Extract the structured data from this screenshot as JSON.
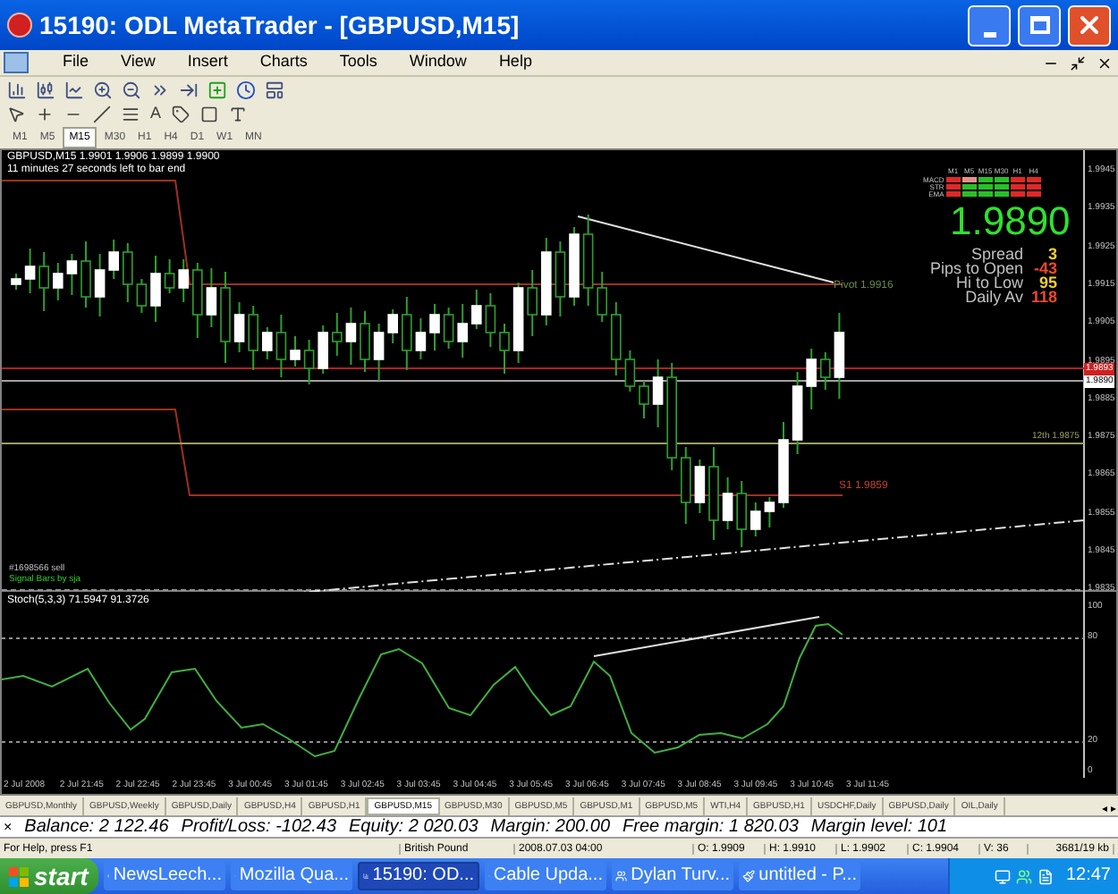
{
  "window": {
    "title": "15190: ODL MetaTrader - [GBPUSD,M15]"
  },
  "menu": [
    "File",
    "View",
    "Insert",
    "Charts",
    "Tools",
    "Window",
    "Help"
  ],
  "text_tool": "A",
  "timeframes": [
    {
      "label": "M1",
      "selected": false
    },
    {
      "label": "M5",
      "selected": false
    },
    {
      "label": "M15",
      "selected": true
    },
    {
      "label": "M30",
      "selected": false
    },
    {
      "label": "H1",
      "selected": false
    },
    {
      "label": "H4",
      "selected": false
    },
    {
      "label": "D1",
      "selected": false
    },
    {
      "label": "W1",
      "selected": false
    },
    {
      "label": "MN",
      "selected": false
    }
  ],
  "chart": {
    "header": "GBPUSD,M15  1.9901 1.9906 1.9899 1.9900",
    "countdown": "11 minutes 27 seconds left to bar end",
    "price_ticks": [
      "1.9945",
      "1.9935",
      "1.9925",
      "1.9915",
      "1.9905",
      "1.9895",
      "1.9885",
      "1.9875",
      "1.9865",
      "1.9855",
      "1.9845",
      "1.9835"
    ],
    "bid_marker": "1.9893",
    "price_marker": "1.9890",
    "signal_rows": [
      "MACD",
      "STR",
      "EMA"
    ],
    "signal_columns": [
      {
        "label": "M1",
        "cells": [
          {
            "color": "#e02828"
          },
          {
            "color": "#e02828"
          },
          {
            "color": "#e02828"
          }
        ]
      },
      {
        "label": "M5",
        "cells": [
          {
            "color": "#e89088"
          },
          {
            "color": "#28c028"
          },
          {
            "color": "#28c028"
          }
        ]
      },
      {
        "label": "M15",
        "cells": [
          {
            "color": "#28c028"
          },
          {
            "color": "#28c028"
          },
          {
            "color": "#28c028"
          }
        ]
      },
      {
        "label": "M30",
        "cells": [
          {
            "color": "#28c028"
          },
          {
            "color": "#28c028"
          },
          {
            "color": "#28c028"
          }
        ]
      },
      {
        "label": "H1",
        "cells": [
          {
            "color": "#e02828"
          },
          {
            "color": "#e02828"
          },
          {
            "color": "#e02828"
          }
        ]
      },
      {
        "label": "H4",
        "cells": [
          {
            "color": "#e02828"
          },
          {
            "color": "#e02828"
          },
          {
            "color": "#e02828"
          }
        ]
      }
    ],
    "big_price": "1.9890",
    "stats": [
      {
        "label": "Spread",
        "value": "3",
        "color": "#f0d030"
      },
      {
        "label": "Pips to Open",
        "value": "-43",
        "color": "#f04830"
      },
      {
        "label": "Hi to Low",
        "value": "95",
        "color": "#f0d030"
      },
      {
        "label": "Daily Av",
        "value": "118",
        "color": "#f04830"
      }
    ],
    "pivot_label": "Pivot 1.9916",
    "level_label": "12th 1.9875",
    "s1_label": "S1 1.9859",
    "order_label": "#1698566 sell",
    "signal_label": "Signal Bars by sja"
  },
  "stoch": {
    "label": "Stoch(5,3,3) 71.5947 91.3726",
    "ticks": [
      "100",
      "80",
      "20",
      "0"
    ]
  },
  "time_axis": [
    "2 Jul 2008",
    "2 Jul 21:45",
    "2 Jul 22:45",
    "2 Jul 23:45",
    "3 Jul 00:45",
    "3 Jul 01:45",
    "3 Jul 02:45",
    "3 Jul 03:45",
    "3 Jul 04:45",
    "3 Jul 05:45",
    "3 Jul 06:45",
    "3 Jul 07:45",
    "3 Jul 08:45",
    "3 Jul 09:45",
    "3 Jul 10:45",
    "3 Jul 11:45"
  ],
  "tabs": [
    {
      "label": "GBPUSD,Monthly",
      "selected": false
    },
    {
      "label": "GBPUSD,Weekly",
      "selected": false
    },
    {
      "label": "GBPUSD,Daily",
      "selected": false
    },
    {
      "label": "GBPUSD,H4",
      "selected": false
    },
    {
      "label": "GBPUSD,H1",
      "selected": false
    },
    {
      "label": "GBPUSD,M15",
      "selected": true
    },
    {
      "label": "GBPUSD,M30",
      "selected": false
    },
    {
      "label": "GBPUSD,M5",
      "selected": false
    },
    {
      "label": "GBPUSD,M1",
      "selected": false
    },
    {
      "label": "GBPUSD,M5",
      "selected": false
    },
    {
      "label": "WTI,H4",
      "selected": false
    },
    {
      "label": "GBPUSD,H1",
      "selected": false
    },
    {
      "label": "USDCHF,Daily",
      "selected": false
    },
    {
      "label": "GBPUSD,Daily",
      "selected": false
    },
    {
      "label": "OIL,Daily",
      "selected": false
    }
  ],
  "tab_scroll": [
    "◂",
    "▸"
  ],
  "account": {
    "close": "×",
    "items": [
      "Balance: 2 122.46",
      "Profit/Loss: -102.43",
      "Equity: 2 020.03",
      "Margin: 200.00",
      "Free margin: 1 820.03",
      "Margin level: 101"
    ]
  },
  "status_bar": [
    "For Help, press F1",
    "British Pound",
    "2008.07.03 04:00",
    "O: 1.9909",
    "H: 1.9910",
    "L: 1.9902",
    "C: 1.9904",
    "V: 36",
    "3681/19 kb"
  ],
  "taskbar": {
    "start": "start",
    "items": [
      {
        "label": "NewsLeech...",
        "selected": false
      },
      {
        "label": "Mozilla Qua...",
        "selected": false
      },
      {
        "label": "15190: OD...",
        "selected": true
      },
      {
        "label": "Cable Upda...",
        "selected": false
      },
      {
        "label": "Dylan Turv...",
        "selected": false
      },
      {
        "label": "untitled - P...",
        "selected": false
      }
    ],
    "clock": "12:47"
  }
}
